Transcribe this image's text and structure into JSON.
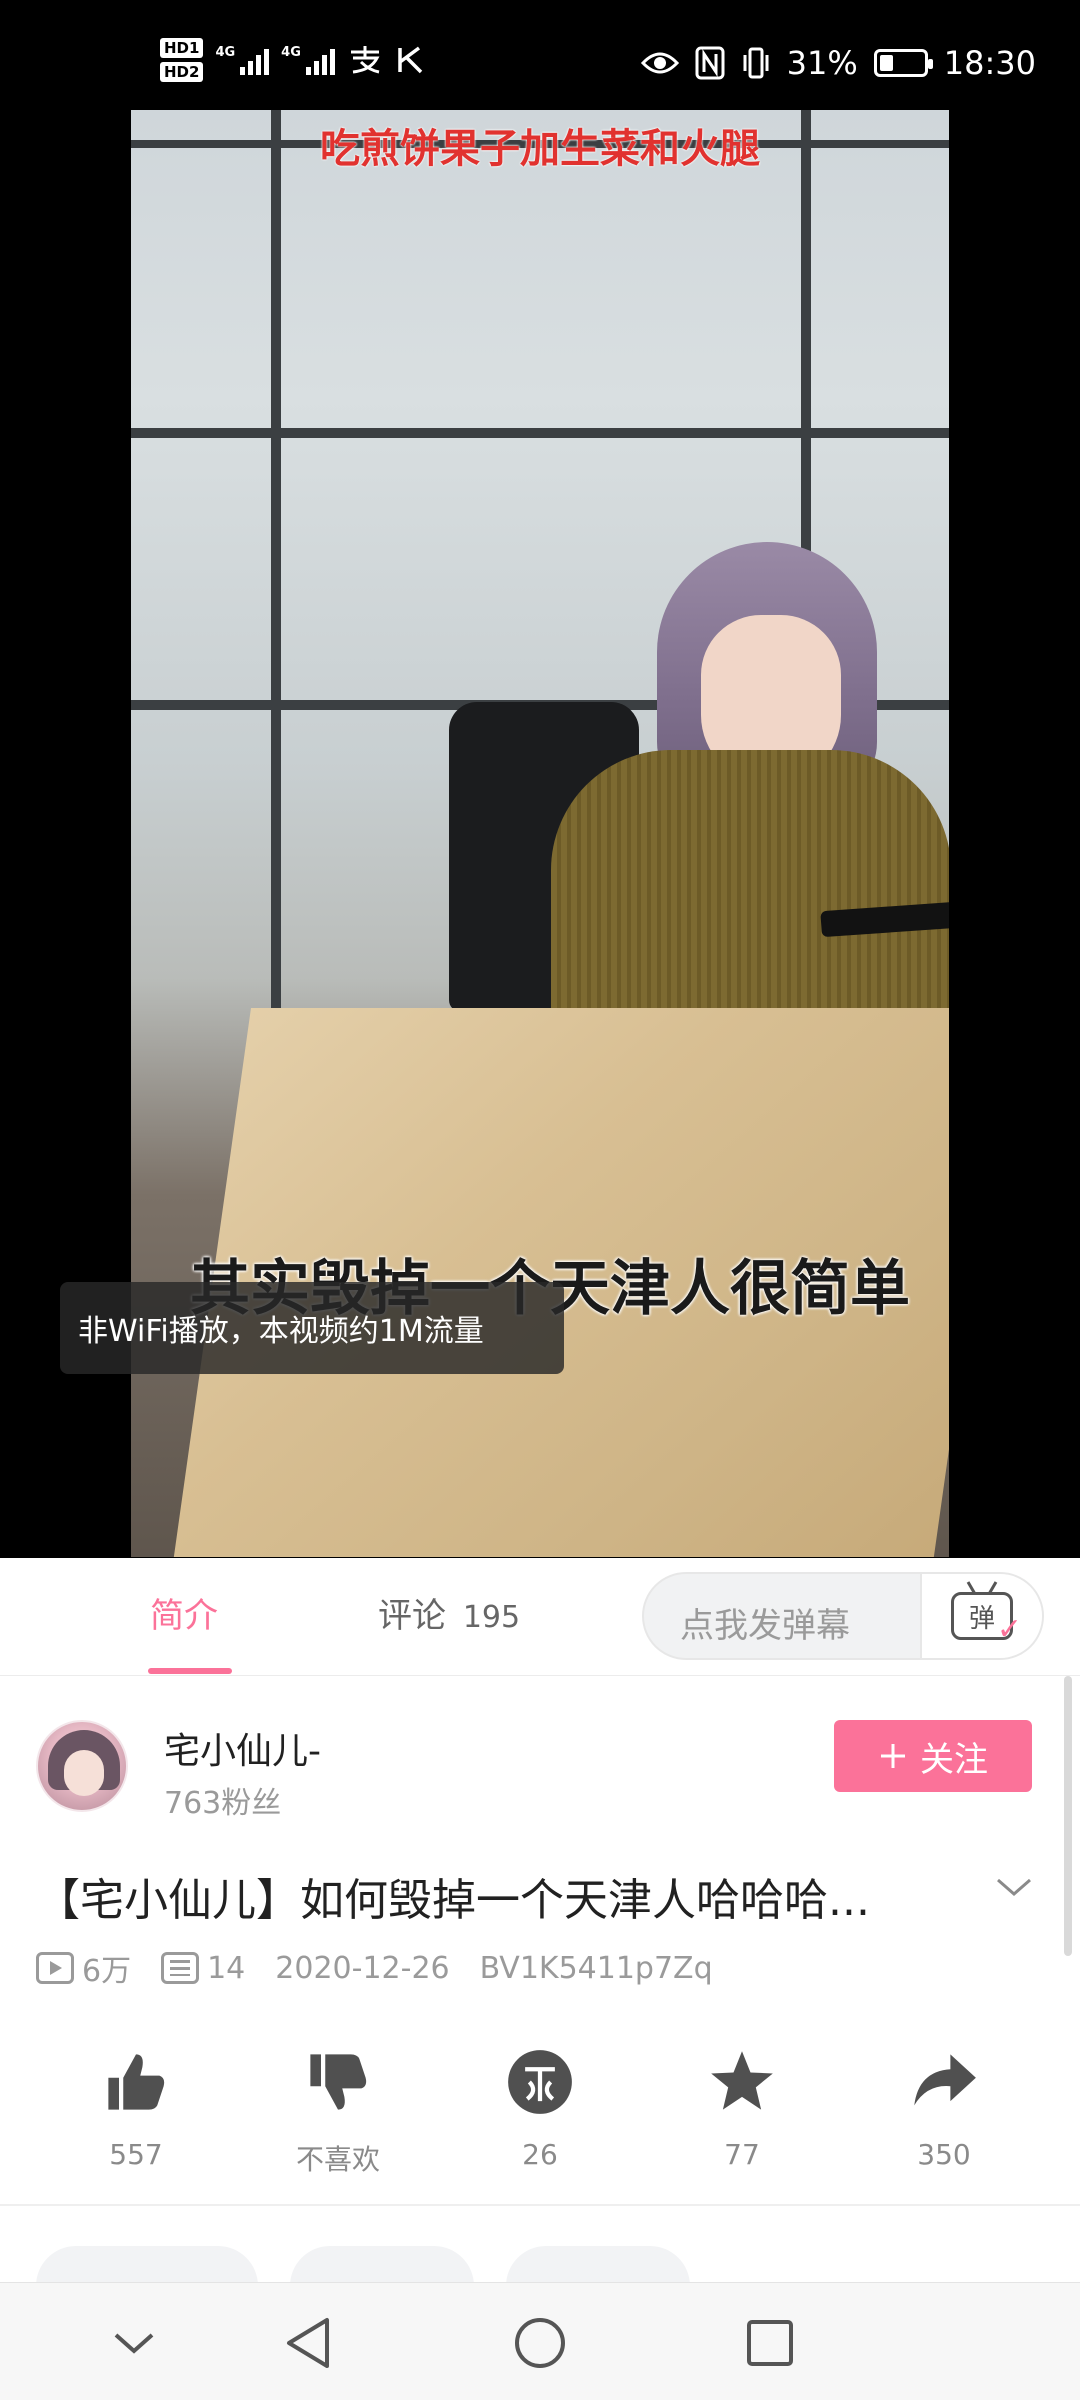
{
  "status_bar": {
    "hd1": "HD1",
    "hd2": "HD2",
    "signal1_label": "4G",
    "signal2_label": "4G",
    "battery_percent": "31%",
    "battery_level": 0.31,
    "time": "18:30",
    "icons": [
      "alipay-icon",
      "notification-k-icon",
      "eye-icon",
      "nfc-icon",
      "vibrate-icon",
      "battery-icon"
    ]
  },
  "video": {
    "overlay_title": "吃煎饼果子加生菜和火腿",
    "subtitle": "其实毁掉一个天津人很简单",
    "traffic_notice": "非WiFi播放，本视频约1M流量"
  },
  "tabs": [
    {
      "label": "简介",
      "count": "",
      "active": true
    },
    {
      "label": "评论",
      "count": "195",
      "active": false
    }
  ],
  "danmaku": {
    "placeholder": "点我发弹幕",
    "toggle_glyph": "弹"
  },
  "uploader": {
    "name": "宅小仙儿-",
    "fans": "763粉丝",
    "follow_label": "关注"
  },
  "info": {
    "title": "【宅小仙儿】如何毁掉一个天津人哈哈哈...",
    "views": "6万",
    "danmaku_count": "14",
    "date": "2020-12-26",
    "bvid": "BV1K5411p7Zq"
  },
  "actions": [
    {
      "name": "like",
      "icon": "thumbs-up-icon",
      "label": "557"
    },
    {
      "name": "dislike",
      "icon": "thumbs-down-icon",
      "label": "不喜欢"
    },
    {
      "name": "coin",
      "icon": "coin-icon",
      "label": "26"
    },
    {
      "name": "favorite",
      "icon": "star-icon",
      "label": "77"
    },
    {
      "name": "share",
      "icon": "share-arrow-icon",
      "label": "350"
    }
  ],
  "colors": {
    "accent": "#fb7299",
    "video_title": "#e1322f",
    "icon_gray": "#505050"
  },
  "navigation": [
    "collapse-chevron-icon",
    "back-triangle-icon",
    "home-circle-icon",
    "recents-square-icon"
  ]
}
